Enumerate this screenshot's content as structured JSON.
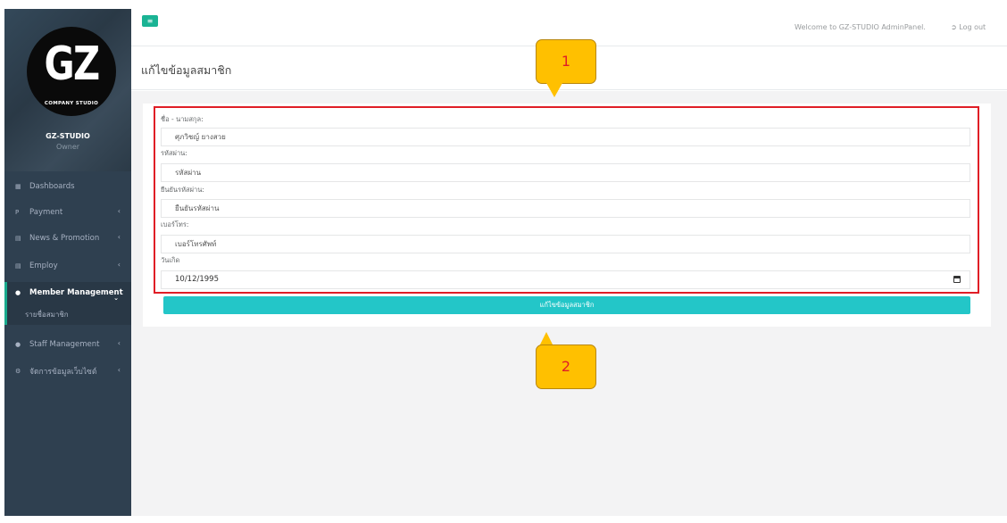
{
  "sidebar": {
    "logo_text": "GZ",
    "logo_subtext": "COMPANY STUDIO",
    "brand_name": "GZ-STUDIO",
    "brand_role": "Owner",
    "items": [
      {
        "label": "Dashboards",
        "icon": "grid-icon"
      },
      {
        "label": "Payment",
        "icon": "paypal-icon"
      },
      {
        "label": "News & Promotion",
        "icon": "newspaper-icon"
      },
      {
        "label": "Employ",
        "icon": "id-card-icon"
      },
      {
        "label": "Member Management",
        "icon": "users-icon"
      },
      {
        "label": "Staff Management",
        "icon": "users-icon"
      },
      {
        "label": "จัดการข้อมูลเว็บไซต์",
        "icon": "gears-icon"
      }
    ],
    "submenu": {
      "label": "รายชื่อสมาชิก"
    }
  },
  "topbar": {
    "welcome": "Welcome to GZ-STUDIO AdminPanel.",
    "logout": "Log out"
  },
  "page": {
    "title": "แก้ไขข้อมูลสมาชิก"
  },
  "form": {
    "name_label": "ชื่อ - นามสกุล:",
    "name_value": "ศุภวิชญ์ ยางสวย",
    "password_label": "รหัสผ่าน:",
    "password_placeholder": "รหัสผ่าน",
    "confirm_label": "ยืนยันรหัสผ่าน:",
    "confirm_placeholder": "ยืนยันรหัสผ่าน",
    "phone_label": "เบอร์โทร:",
    "phone_placeholder": "เบอร์โทรศัพท์",
    "birthday_label": "วันเกิด",
    "birthday_value": "10/12/1995",
    "submit_label": "แก้ไขข้อมูลสมาชิก"
  },
  "callouts": {
    "one": "1",
    "two": "2"
  },
  "colors": {
    "sidebar_bg": "#2f4050",
    "accent_green": "#1ab394",
    "submit_teal": "#23c6c8",
    "highlight_red": "#e01e26",
    "callout_yellow": "#ffc000"
  }
}
